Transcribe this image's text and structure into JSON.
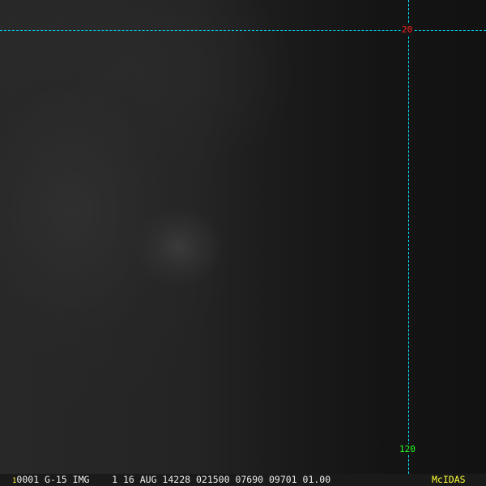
{
  "image": {
    "grid_color": "#00e5ff",
    "lat_label_color": "#ff2020",
    "lon_label_color": "#22ff22"
  },
  "grid": {
    "latitude_label": "20",
    "longitude_label": "120"
  },
  "status_bar": {
    "frame": "1",
    "info": "0001 G-15 IMG    1 16 AUG 14228 021500 07690 09701 01.00",
    "brand": "McIDAS"
  }
}
